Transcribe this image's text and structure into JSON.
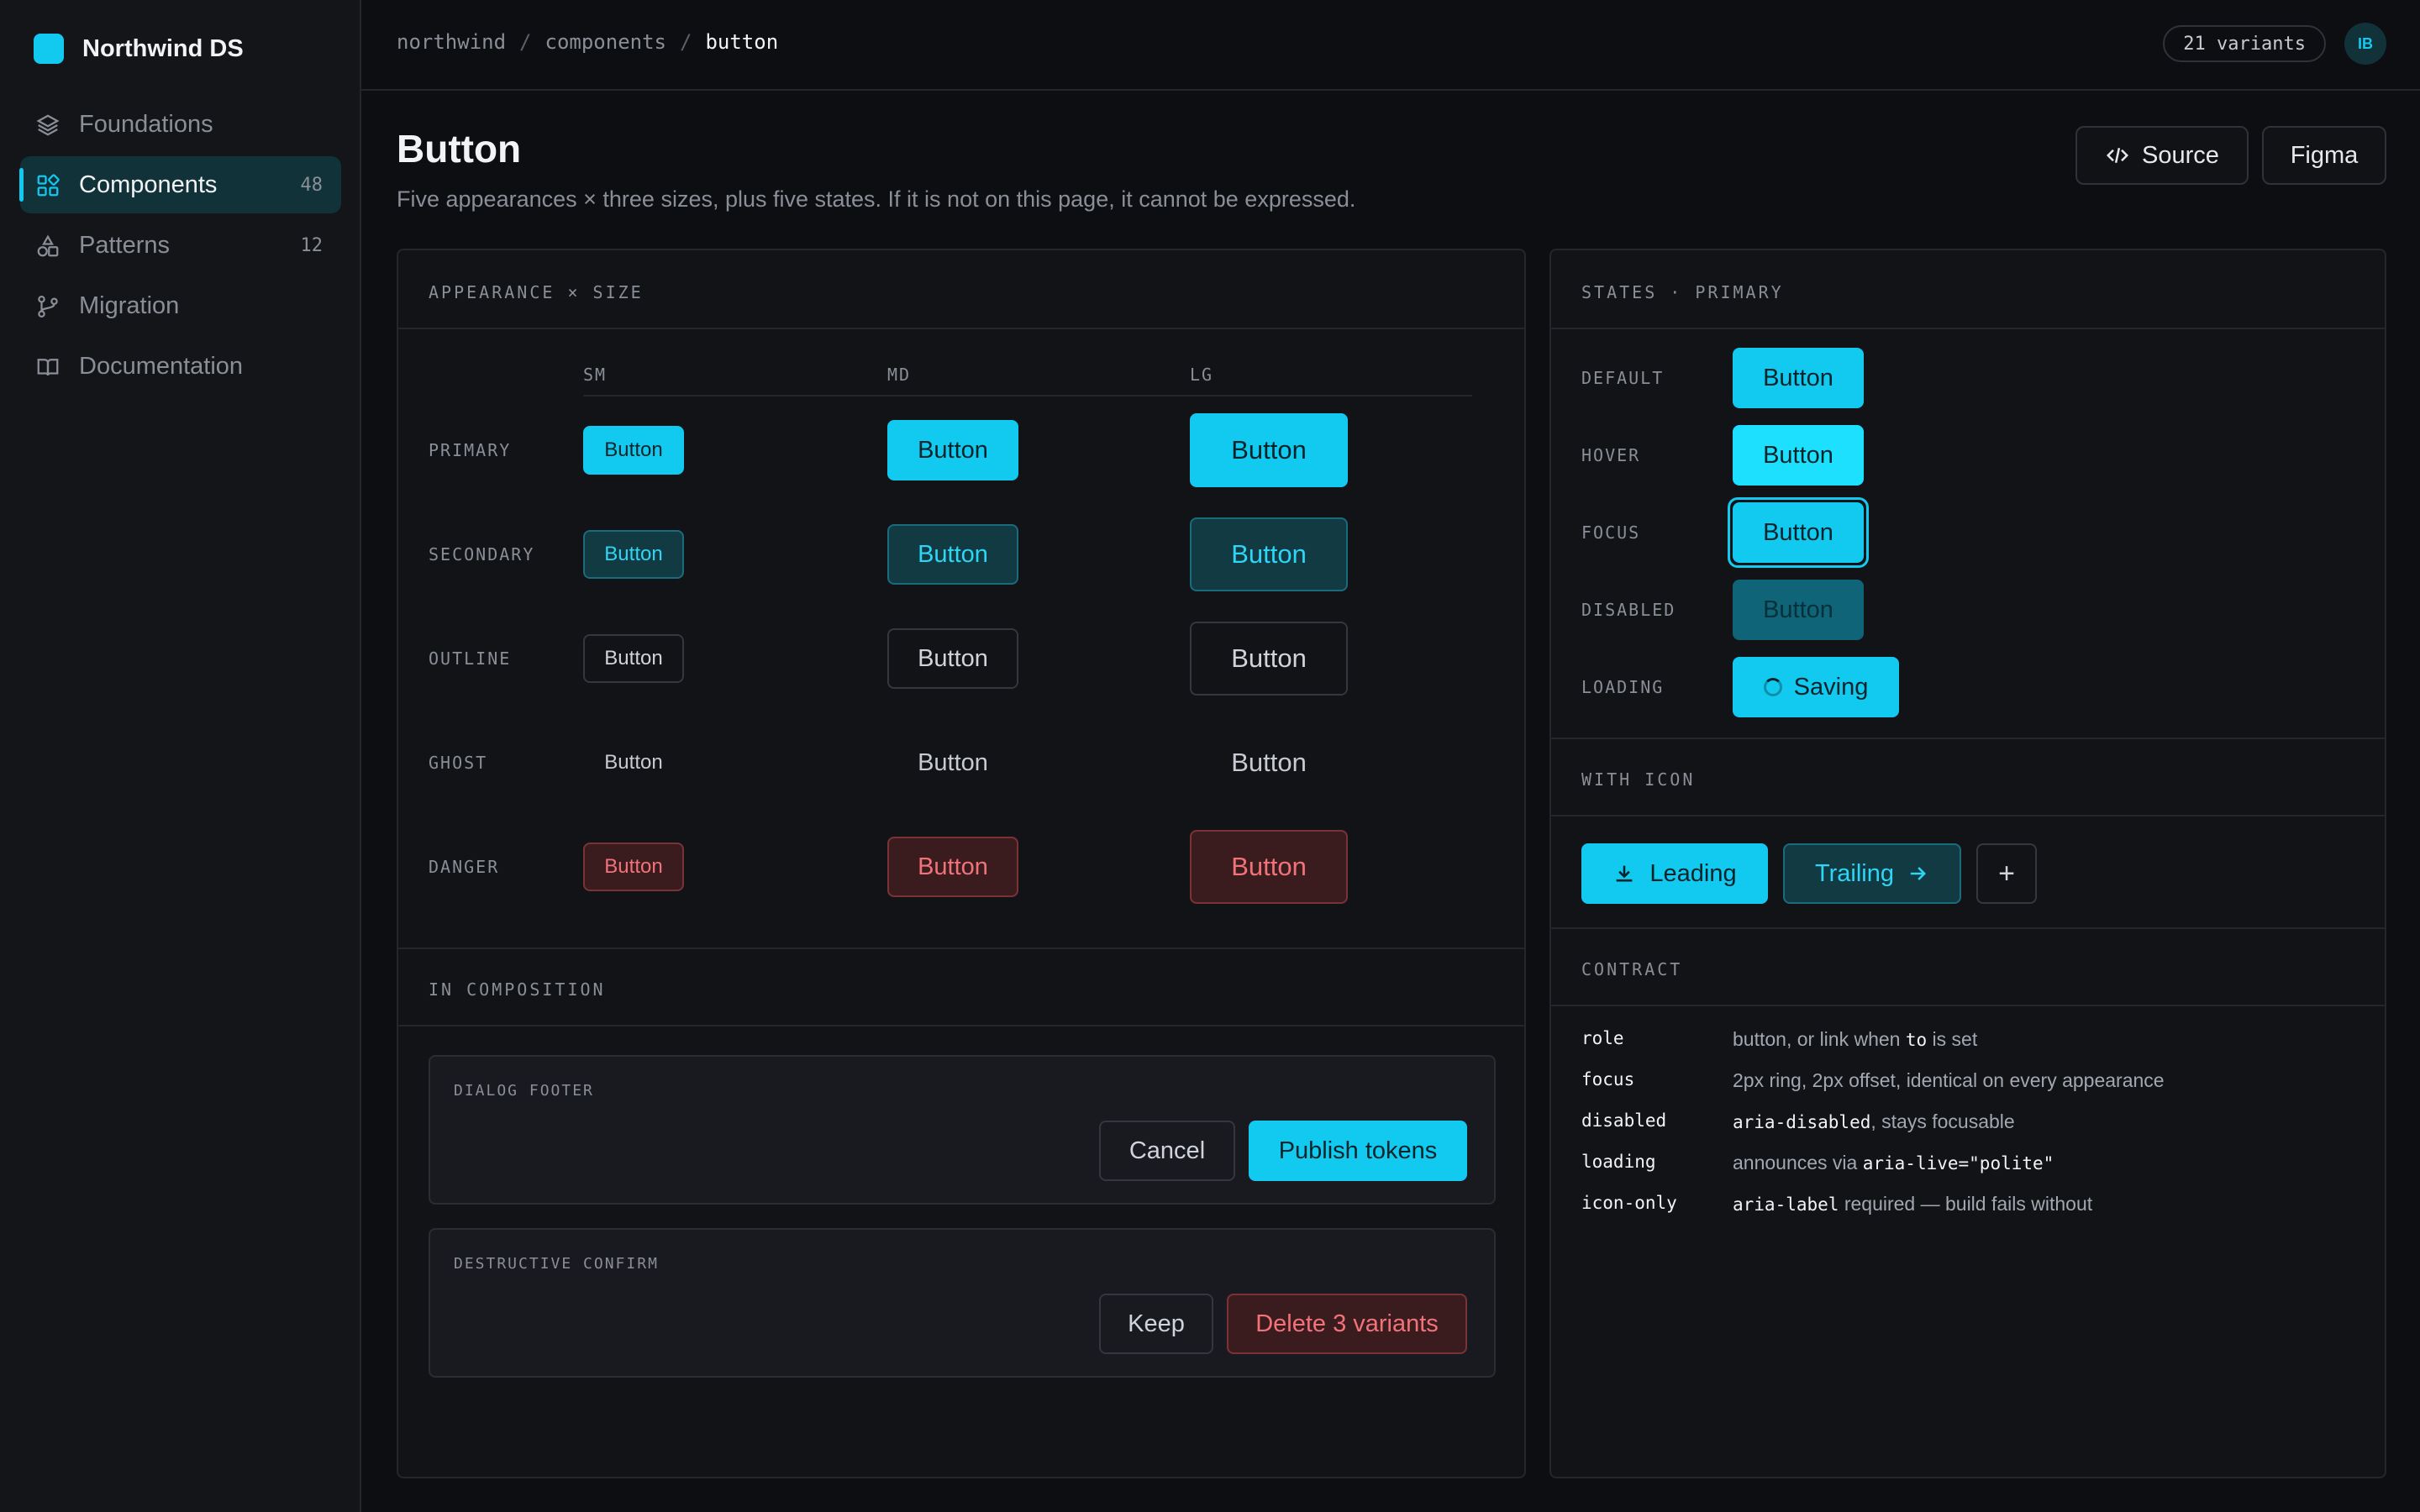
{
  "brand": {
    "name": "Northwind DS"
  },
  "sidebar": {
    "items": [
      {
        "label": "Foundations",
        "icon": "layers-icon",
        "count": ""
      },
      {
        "label": "Components",
        "icon": "grid-icon",
        "count": "48"
      },
      {
        "label": "Patterns",
        "icon": "shapes-icon",
        "count": "12"
      },
      {
        "label": "Migration",
        "icon": "branch-icon",
        "count": ""
      },
      {
        "label": "Documentation",
        "icon": "book-icon",
        "count": ""
      }
    ]
  },
  "topbar": {
    "breadcrumb": [
      "northwind",
      "components",
      "button"
    ],
    "variants": "21 variants",
    "avatar": "IB"
  },
  "page": {
    "title": "Button",
    "subtitle": "Five appearances × three sizes, plus five states. If it is not on this page, it cannot be expressed.",
    "source_label": "Source",
    "figma_label": "Figma"
  },
  "matrix": {
    "heading": "APPEARANCE × SIZE",
    "columns": [
      "SM",
      "MD",
      "LG"
    ],
    "rows": [
      "PRIMARY",
      "SECONDARY",
      "OUTLINE",
      "GHOST",
      "DANGER"
    ],
    "button_label": "Button"
  },
  "composition": {
    "heading": "IN COMPOSITION",
    "dialog": {
      "label": "DIALOG FOOTER",
      "cancel": "Cancel",
      "confirm": "Publish tokens"
    },
    "destructive": {
      "label": "DESTRUCTIVE CONFIRM",
      "keep": "Keep",
      "delete": "Delete 3 variants"
    }
  },
  "states": {
    "heading": "STATES · PRIMARY",
    "labels": [
      "DEFAULT",
      "HOVER",
      "FOCUS",
      "DISABLED",
      "LOADING"
    ],
    "button_label": "Button",
    "loading_label": "Saving"
  },
  "with_icon": {
    "heading": "WITH ICON",
    "leading": "Leading",
    "trailing": "Trailing",
    "icon_only": "+"
  },
  "contract": {
    "heading": "CONTRACT",
    "rows": [
      {
        "key": "role",
        "parts": [
          "button, or link when ",
          "to",
          " is set"
        ]
      },
      {
        "key": "focus",
        "parts": [
          "2px ring, 2px offset, identical on every appearance"
        ]
      },
      {
        "key": "disabled",
        "parts": [
          "aria-disabled",
          ", stays focusable"
        ]
      },
      {
        "key": "loading",
        "parts": [
          "announces via ",
          "aria-live=\"polite\""
        ]
      },
      {
        "key": "icon-only",
        "parts": [
          "aria-label",
          " required — build fails without"
        ]
      }
    ]
  },
  "colors": {
    "accent": "#12c9ef",
    "danger": "#f2727a",
    "background": "#0d0e11"
  }
}
